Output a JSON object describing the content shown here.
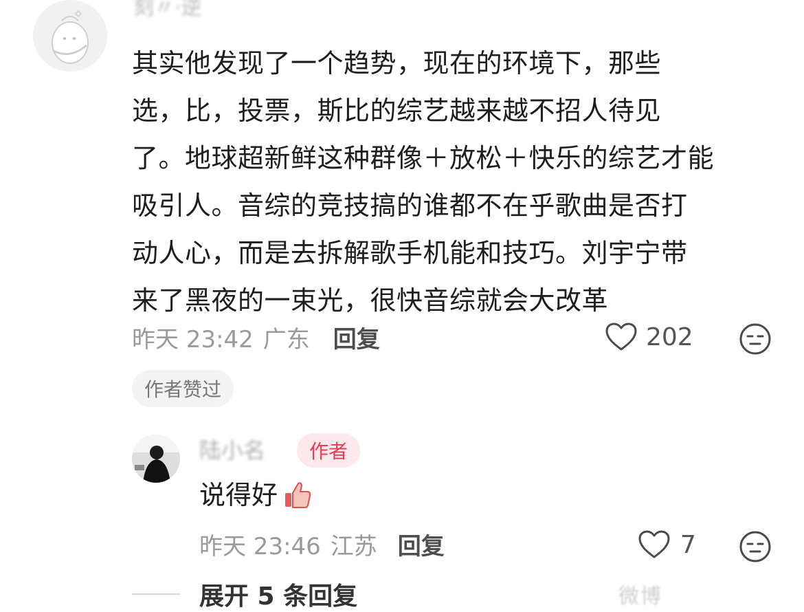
{
  "top_comment": {
    "username": "刻〃·逆",
    "lines": [
      "其实他发现了一个趋势，现在的环境下，那些",
      "选，比，投票，斯比的综艺越来越不招人待见",
      "了。地球超新鲜这种群像＋放松＋快乐的综艺才能",
      "吸引人。音综的竞技搞的谁都不在乎歌曲是否打",
      "动人心，而是去拆解歌手机能和技巧。刘宇宁带",
      "来了黑夜的一束光，很快音综就会大改革"
    ],
    "time": "昨天 23:42",
    "location": "广东",
    "reply_label": "回复",
    "likes": "202",
    "author_liked_label": "作者赞过"
  },
  "reply": {
    "username": "陆小名",
    "author_badge": "作者",
    "text": "说得好",
    "time": "昨天 23:46",
    "location": "江苏",
    "reply_label": "回复",
    "likes": "7"
  },
  "expand_label": "展开 5 条回复",
  "watermark": "微博"
}
